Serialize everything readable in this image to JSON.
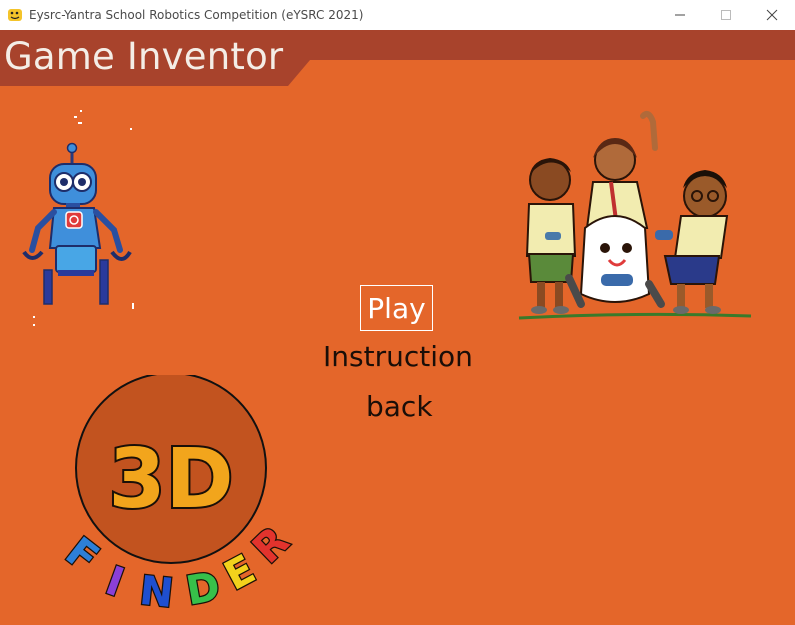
{
  "window": {
    "title": "Eysrc-Yantra School Robotics Competition (eYSRC 2021)",
    "controls": [
      "minimize-icon",
      "maximize-icon",
      "close-icon"
    ]
  },
  "header": {
    "title": "Game Inventor",
    "band_color": "#a8432c"
  },
  "menu": {
    "play_label": "Play",
    "instruction_label": "Instruction",
    "back_label": "back",
    "selected": "Play"
  },
  "logo": {
    "main_text": "3D",
    "sub_text": "FINDER",
    "sub_letters": [
      "F",
      "I",
      "N",
      "D",
      "E",
      "R"
    ],
    "sub_letter_colors": [
      "#2d7fd8",
      "#8b3fd6",
      "#1f4fd0",
      "#37c04a",
      "#f2d21c",
      "#e2332d"
    ]
  },
  "colors": {
    "background": "#e4662a",
    "header_band": "#a8432c",
    "logo_circle": "#c2531f",
    "selected_text": "#ffffff",
    "menu_text": "#1a0e08"
  },
  "illustrations": [
    "robot-illustration",
    "kids-gaming-illustration"
  ]
}
